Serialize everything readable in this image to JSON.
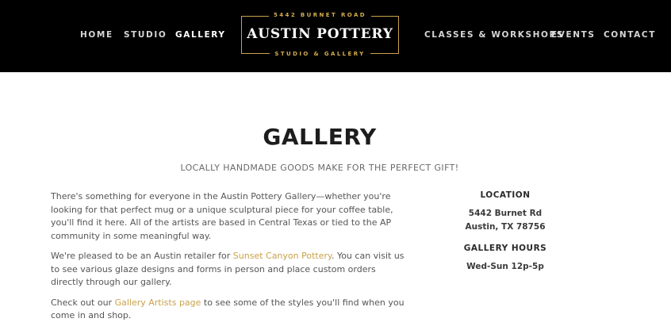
{
  "nav": {
    "left": [
      "HOME",
      "STUDIO",
      "GALLERY"
    ],
    "right": [
      "CLASSES & WORKSHOPS",
      "EVENTS",
      "CONTACT"
    ],
    "active": "GALLERY"
  },
  "logo": {
    "address": "5442 BURNET ROAD",
    "name": "AUSTIN POTTERY",
    "tagline": "STUDIO & GALLERY"
  },
  "page": {
    "title": "GALLERY",
    "subtitle": "LOCALLY HANDMADE GOODS MAKE FOR THE PERFECT GIFT!"
  },
  "content": {
    "p1": "There's something for everyone in the Austin Pottery Gallery—whether you're looking for that perfect mug or a unique sculptural piece for your coffee table, you'll find it here. All of the artists are based in Central Texas or tied to the AP community in some meaningful way.",
    "p2_before": "We're pleased to be an Austin retailer for ",
    "p2_link": "Sunset Canyon Pottery",
    "p2_after": ". You can visit us to see various glaze designs and forms in person and place custom orders directly through our gallery.",
    "p3_before": "Check out our ",
    "p3_link": "Gallery Artists page",
    "p3_after": " to see some of the styles you'll find when you come in and shop."
  },
  "sidebar": {
    "location_heading": "LOCATION",
    "address_line1": "5442 Burnet Rd",
    "address_line2": "Austin, TX 78756",
    "hours_heading": "GALLERY HOURS",
    "hours": "Wed-Sun 12p-5p"
  },
  "colors": {
    "header_bg": "#000000",
    "accent_gold": "#c9a24a",
    "link": "#c9a24a"
  }
}
